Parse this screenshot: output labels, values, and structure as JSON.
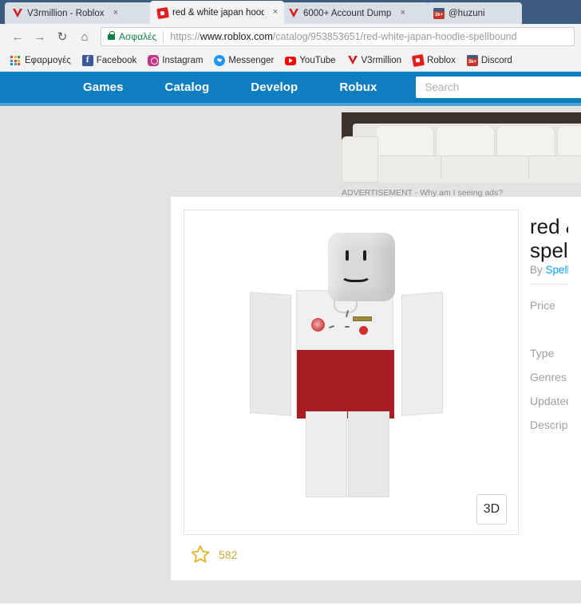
{
  "browser": {
    "tabs": [
      {
        "title": "V3rmillion - Roblox",
        "favicon": "v3rmillion-icon",
        "active": false,
        "close_label": "×"
      },
      {
        "title": "red & white japan hoodie",
        "favicon": "roblox-icon",
        "active": true,
        "close_label": "×"
      },
      {
        "title": "6000+ Account Dump",
        "favicon": "v3rmillion-icon",
        "active": false,
        "close_label": "×"
      },
      {
        "title": "@huzuni",
        "favicon": "huzuni-3k-icon",
        "active": false,
        "close_label": ""
      }
    ],
    "toolbar": {
      "back_label": "←",
      "forward_label": "→",
      "reload_label": "↻",
      "home_label": "⌂",
      "secure_label": "Ασφαλές",
      "url_scheme": "https://",
      "url_host": "www.roblox.com",
      "url_path": "/catalog/953853651/red-white-japan-hoodie-spellbound"
    },
    "bookmarks": [
      {
        "label": "Εφαρμογές",
        "icon": "apps-grid-icon"
      },
      {
        "label": "Facebook",
        "icon": "facebook-icon",
        "glyph": "f"
      },
      {
        "label": "Instagram",
        "icon": "instagram-icon"
      },
      {
        "label": "Messenger",
        "icon": "messenger-icon"
      },
      {
        "label": "YouTube",
        "icon": "youtube-icon"
      },
      {
        "label": "V3rmillion",
        "icon": "v3rmillion-icon"
      },
      {
        "label": "Roblox",
        "icon": "roblox-icon"
      },
      {
        "label": "Discord",
        "icon": "huzuni-3k-icon",
        "glyph": "3k+"
      }
    ]
  },
  "roblox_nav": {
    "menu_label": "menu",
    "logo_label": "Roblox",
    "links": [
      "Games",
      "Catalog",
      "Develop",
      "Robux"
    ],
    "search_placeholder": "Search",
    "search_value": ""
  },
  "advertisement": {
    "label": "ADVERTISEMENT - Why am I seeing ads?"
  },
  "item": {
    "title_line1": "red &",
    "title_line2": "spellb",
    "by_prefix": "By ",
    "creator": "Spellbo",
    "favorites_count": "582",
    "view_3d_label": "3D",
    "fields": [
      {
        "label": "Price",
        "value": ""
      },
      {
        "label": "Type",
        "value": ""
      },
      {
        "label": "Genres",
        "value": ""
      },
      {
        "label": "Updated",
        "value": ""
      },
      {
        "label": "Description",
        "value": ""
      }
    ]
  },
  "colors": {
    "roblox_blue": "#0f7ec0",
    "nav_underline": "#4ca1d4",
    "page_bg": "#e3e3e3",
    "link_blue": "#00a2ff",
    "star_gold": "#e0b932",
    "secure_green": "#0b8043"
  }
}
